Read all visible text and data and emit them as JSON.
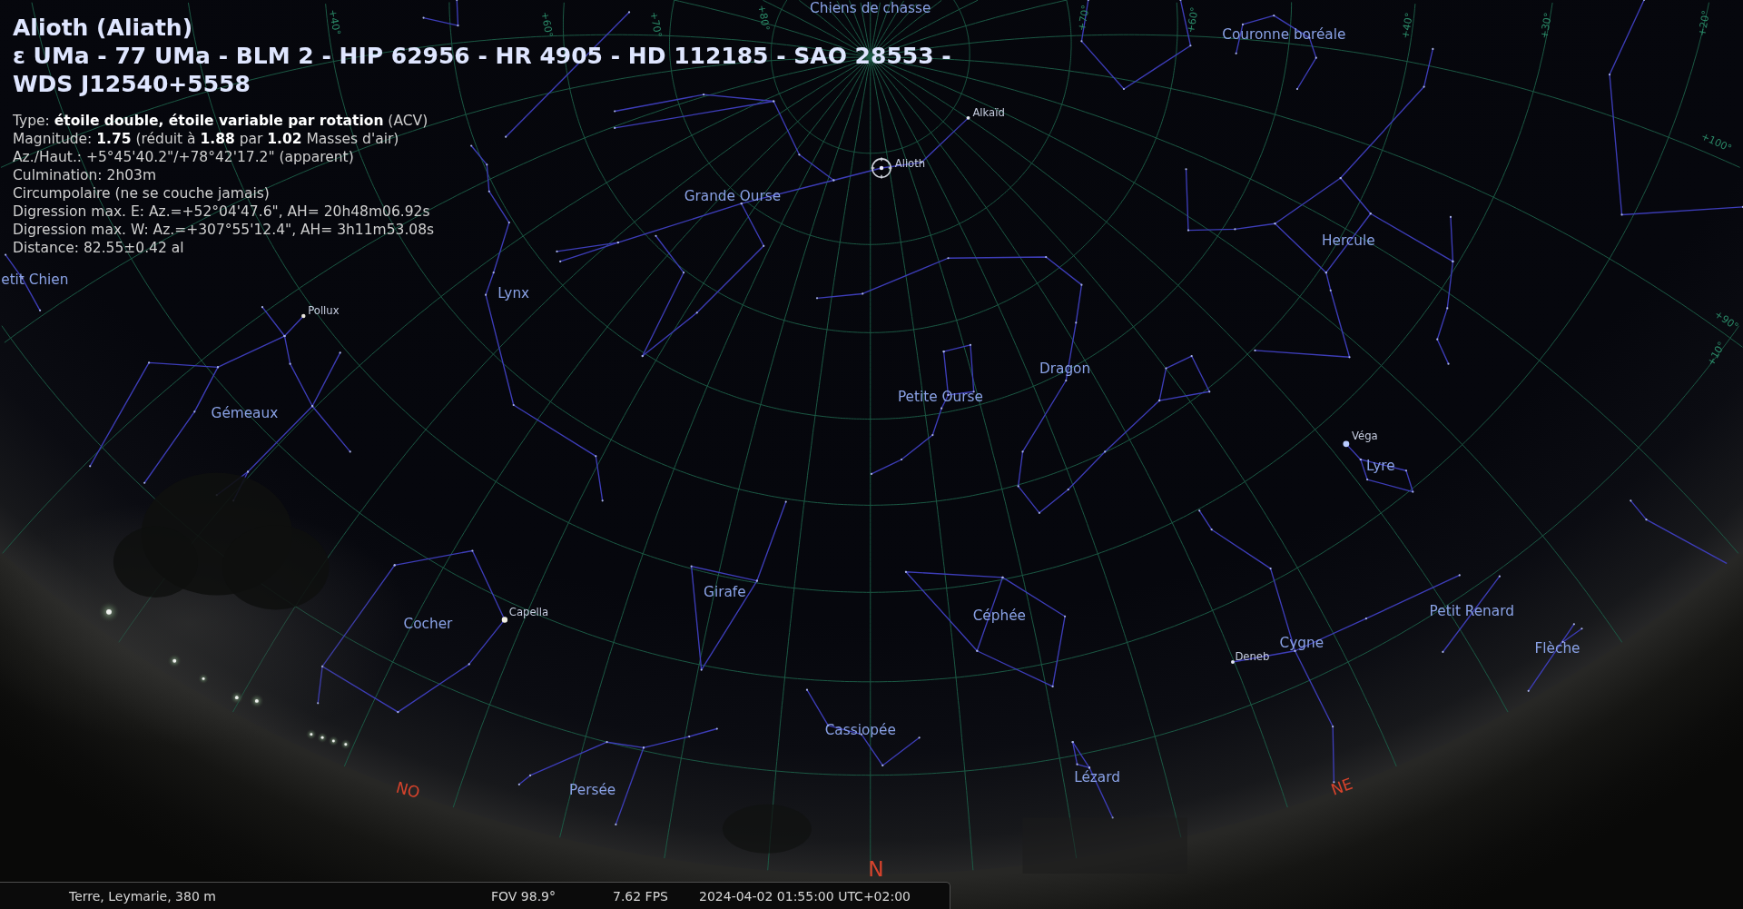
{
  "selected_object": {
    "title": "Alioth (Aliath)",
    "designations": "ε UMa - 77 UMa - BLM 2 - HIP 62956 - HR 4905 - HD 112185 - SAO 28553 -\nWDS J12540+5558",
    "details": [
      "Type: **étoile double, étoile variable par rotation** (ACV)",
      "Magnitude: **1.75** (réduit à **1.88** par **1.02** Masses d'air)",
      "Az./Haut.: +5°45'40.2\"/+78°42'17.2\" (apparent)",
      "Culmination: 2h03m",
      "Circumpolaire (ne se couche jamais)",
      "Digression max. E: Az.=+52°04'47.6\", AH= 20h48m06.92s",
      "Digression max. W: Az.=+307°55'12.4\", AH= 3h11m53.08s",
      "Distance: 82.55±0.42 al"
    ]
  },
  "sky": {
    "constellations": [
      "Chiens de chasse",
      "Couronne boréale",
      "Grande Ourse",
      "Hercule",
      "etit Chien",
      "Lynx",
      "Dragon",
      "Petite Ourse",
      "Gémeaux",
      "Lyre",
      "Girafe",
      "Petit Renard",
      "Céphée",
      "Cocher",
      "Cygne",
      "Flèche",
      "Cassiopée",
      "Lézard",
      "Persée"
    ],
    "stars": [
      {
        "name": "Alkaïd",
        "selected": false
      },
      {
        "name": "Alioth",
        "selected": true
      },
      {
        "name": "Pollux",
        "selected": false
      },
      {
        "name": "Capella",
        "selected": false
      },
      {
        "name": "Véga",
        "selected": false
      },
      {
        "name": "Deneb",
        "selected": false
      }
    ],
    "grid_labels": [
      "+40°",
      "+60°",
      "+70°",
      "+80°",
      "+70°",
      "+60°",
      "+40°",
      "+30°",
      "+20°",
      "+100°",
      "+90°",
      "+10°"
    ],
    "cardinal_points": [
      "NO",
      "N",
      "NE"
    ]
  },
  "status_bar": {
    "location": "Terre, Leymarie, 380 m",
    "fov": "FOV 98.9°",
    "fps": "7.62 FPS",
    "datetime": "2024-04-02 01:55:00 UTC+02:00"
  }
}
